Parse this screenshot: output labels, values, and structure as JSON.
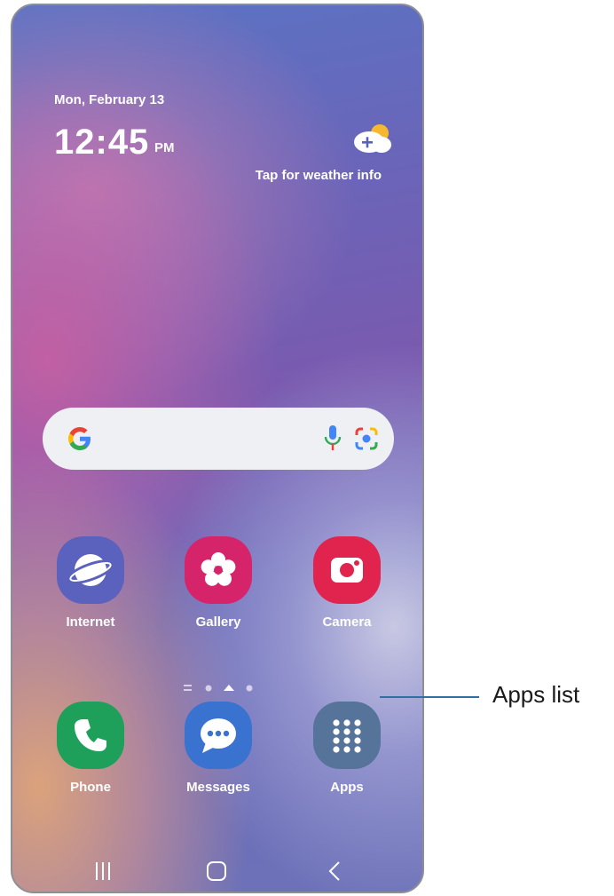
{
  "status": {
    "date": "Mon, February 13",
    "time": "12:45",
    "ampm": "PM"
  },
  "weather": {
    "text": "Tap for weather info",
    "icon": "weather-add-icon"
  },
  "search_bar": {
    "icons": [
      "google-logo-icon",
      "microphone-icon",
      "google-lens-icon"
    ]
  },
  "apps_row": [
    {
      "label": "Internet",
      "icon": "internet-icon",
      "color": "#5a62bd"
    },
    {
      "label": "Gallery",
      "icon": "gallery-icon",
      "color": "#d6246a"
    },
    {
      "label": "Camera",
      "icon": "camera-icon",
      "color": "#e0244e"
    }
  ],
  "dock": [
    {
      "label": "Phone",
      "icon": "phone-icon",
      "color": "#1fa05a"
    },
    {
      "label": "Messages",
      "icon": "messages-icon",
      "color": "#3a72d0"
    },
    {
      "label": "Apps",
      "icon": "apps-grid-icon",
      "color": "#56739a"
    }
  ],
  "page_indicator": {
    "pages": 4,
    "active": 3
  },
  "navigation": [
    "recent-apps-icon",
    "home-icon",
    "back-icon"
  ],
  "callout": {
    "text": "Apps list",
    "line_color": "#2f6fa3"
  }
}
